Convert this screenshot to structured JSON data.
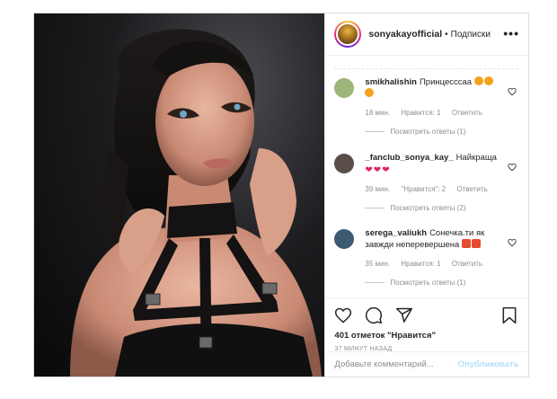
{
  "post": {
    "author": "sonyakayofficial",
    "separator": "•",
    "follow_label": "Подписки",
    "more_label": "•••"
  },
  "comments": [
    {
      "user": "smikhalishin",
      "text": "Принцесссаа",
      "emojis": [
        "star",
        "star",
        "star"
      ],
      "time": "18 мин.",
      "likes": "Нравится: 1",
      "reply": "Ответить",
      "view_replies": "Посмотреть ответы (1)",
      "avatar_color": "#9bb57a"
    },
    {
      "user": "_fanclub_sonya_kay_",
      "text": "Найкраща",
      "emojis": [
        "heart",
        "heart",
        "heart"
      ],
      "time": "39 мин.",
      "likes": "\"Нравится\": 2",
      "reply": "Ответить",
      "view_replies": "Посмотреть ответы (2)",
      "avatar_color": "#5a4e4a"
    },
    {
      "user": "serega_valiukh",
      "text": "Сонечка.ти як завжди неперевершена",
      "emojis": [
        "cross",
        "cross"
      ],
      "time": "35 мин.",
      "likes": "Нравится: 1",
      "reply": "Ответить",
      "view_replies": "Посмотреть ответы (1)",
      "avatar_color": "#3d5a73"
    }
  ],
  "actions": {
    "likes_text": "401 отметок \"Нравится\"",
    "time_text": "37 МИНУТ НАЗАД"
  },
  "composer": {
    "placeholder": "Добавьте комментарий...",
    "publish_label": "Опубликовать"
  },
  "icons": {
    "like": "heart-icon",
    "comment": "comment-icon",
    "share": "share-icon",
    "save": "bookmark-icon",
    "comment_like": "small-heart-icon"
  },
  "colors": {
    "heart_emoji": "#e0245e",
    "publish_disabled": "#b2dffc",
    "meta_text": "#8e8e8e"
  }
}
